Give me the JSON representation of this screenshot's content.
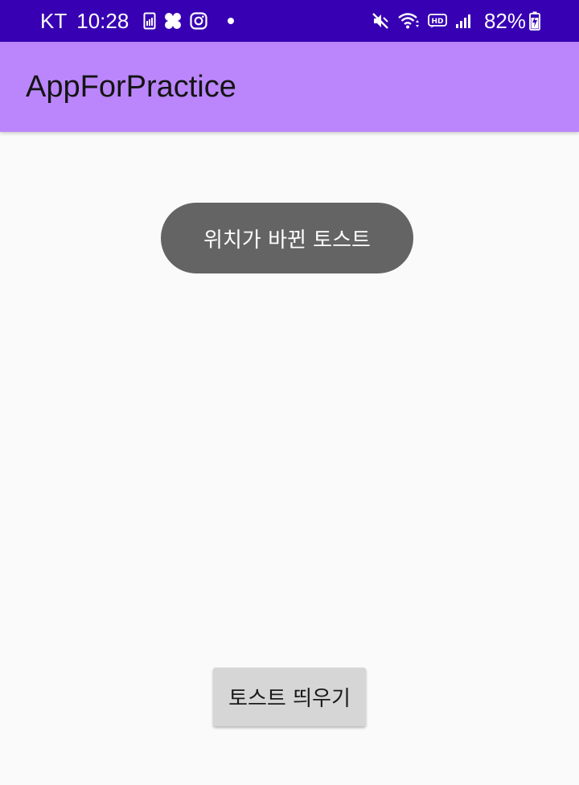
{
  "status_bar": {
    "carrier": "KT",
    "time": "10:28",
    "battery_percent": "82%",
    "left_icons": [
      "sim-card-icon",
      "app-notification-icon",
      "instagram-icon",
      "dot-icon"
    ],
    "right_icons": [
      "mute-icon",
      "wifi-icon",
      "hd-icon",
      "signal-icon",
      "battery-charging-icon"
    ],
    "background_color": "#3700b3"
  },
  "app_bar": {
    "title": "AppForPractice",
    "background_color": "#bb86fc"
  },
  "toast": {
    "message": "위치가 바뀐 토스트",
    "background_color": "#646464"
  },
  "main": {
    "show_toast_button_label": "토스트 띄우기"
  }
}
